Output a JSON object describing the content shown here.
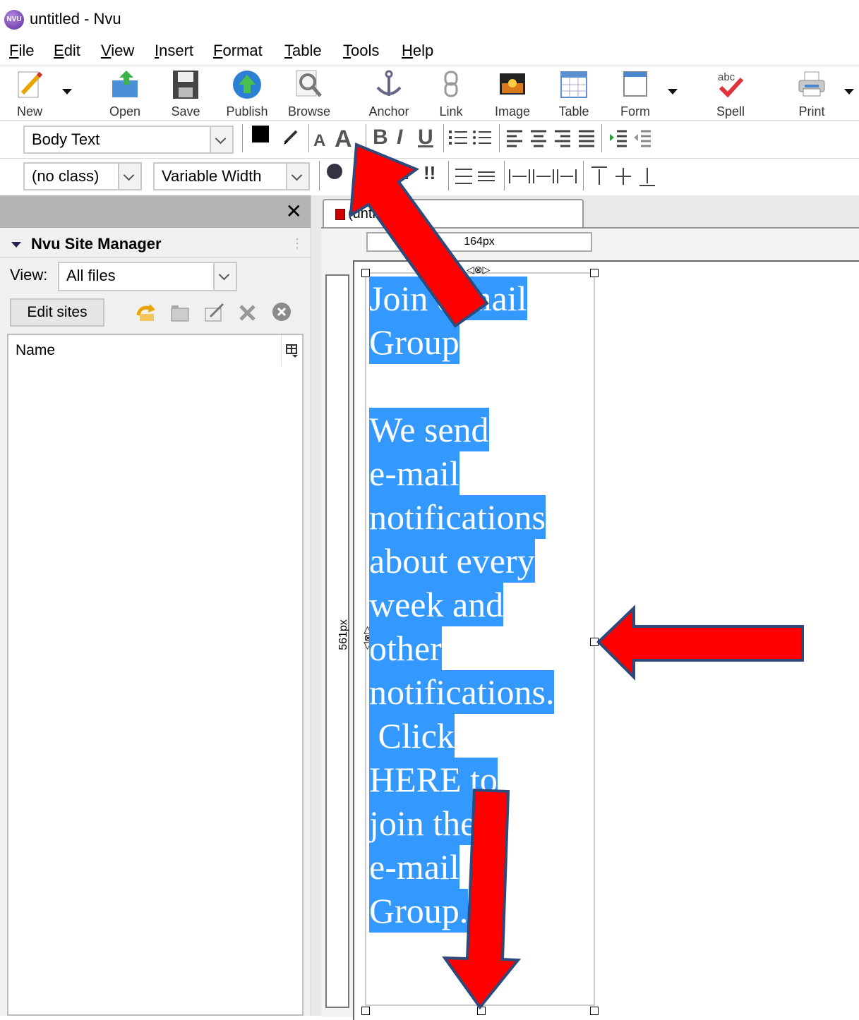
{
  "window": {
    "title": "untitled - Nvu",
    "app_icon_text": "NVU"
  },
  "menu": [
    "File",
    "Edit",
    "View",
    "Insert",
    "Format",
    "Table",
    "Tools",
    "Help"
  ],
  "toolbar": {
    "new": "New",
    "open": "Open",
    "save": "Save",
    "publish": "Publish",
    "browse": "Browse",
    "anchor": "Anchor",
    "link": "Link",
    "image": "Image",
    "table": "Table",
    "form": "Form",
    "spell": "Spell",
    "print": "Print"
  },
  "format": {
    "paragraph_style": "Body Text",
    "class": "(no class)",
    "font": "Variable Width",
    "bold": "B",
    "italic": "I",
    "underline": "U",
    "smaller_font": "A",
    "larger_font": "A"
  },
  "sidebar": {
    "close": "✕",
    "title": "Nvu Site Manager",
    "view_label": "View:",
    "view_value": "All files",
    "edit_sites": "Edit sites",
    "column_name": "Name"
  },
  "editor": {
    "tab_label": "(unti",
    "width_label": "164px",
    "height_label": "561px",
    "selected_lines": [
      "Join e-mail",
      "Group",
      "",
      "We send",
      "e-mail",
      "notifications",
      "about every",
      "week and",
      "other",
      "notifications.",
      " Click",
      "HERE to",
      "join the",
      "e-mail",
      "Group."
    ]
  },
  "colors": {
    "selection": "#3399ff",
    "arrow_fill": "#ff0000",
    "arrow_stroke": "#2e4a7a"
  }
}
